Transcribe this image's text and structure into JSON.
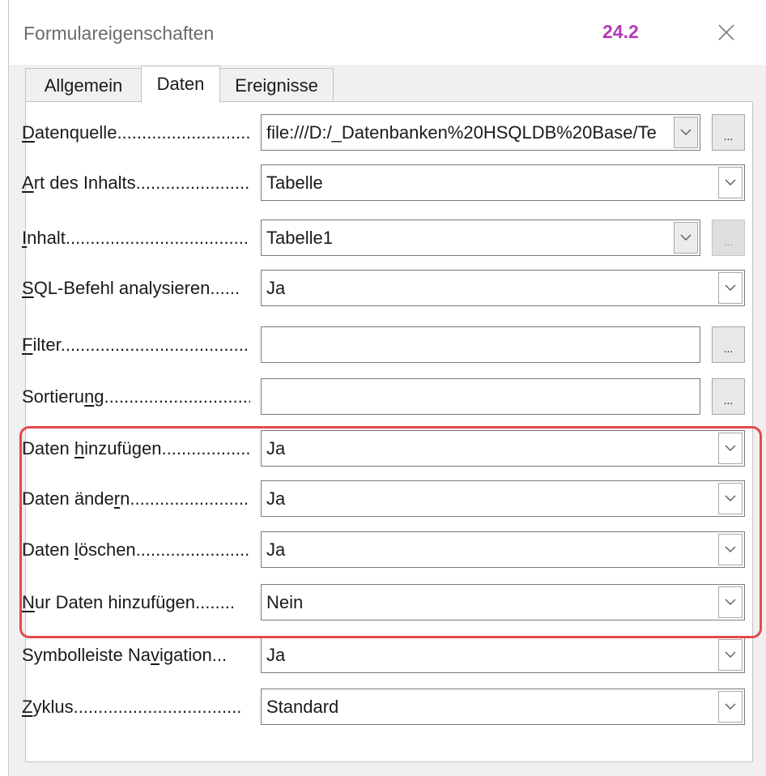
{
  "window": {
    "title": "Formulareigenschaften",
    "version": "24.2"
  },
  "tabs": [
    {
      "label": "Allgemein",
      "active": false
    },
    {
      "label": "Daten",
      "active": true
    },
    {
      "label": "Ereignisse",
      "active": false
    }
  ],
  "rows": [
    {
      "label_pre": "",
      "label_u": "D",
      "label_post": "atenquelle",
      "dots": "...............................",
      "value": "file:///D:/_Datenbanken%20HSQLDB%20Base/Te",
      "more": true,
      "more_label": "..."
    },
    {
      "label_pre": "",
      "label_u": "A",
      "label_post": "rt des Inhalts",
      "dots": ".........................",
      "value": "Tabelle"
    },
    {
      "label_pre": "",
      "label_u": "I",
      "label_post": "nhalt",
      "dots": "......................................",
      "value": "Tabelle1",
      "more": true,
      "more_label": "...",
      "more_disabled": true
    },
    {
      "label_pre": "",
      "label_u": "S",
      "label_post": "QL-Befehl analysieren",
      "dots": "......",
      "value": "Ja"
    },
    {
      "label_pre": "",
      "label_u": "F",
      "label_post": "ilter",
      "dots": "........................................",
      "value": "",
      "more": true,
      "more_label": "..."
    },
    {
      "label_pre": "Sortieru",
      "label_u": "n",
      "label_post": "g",
      "dots": "..................................",
      "value": "",
      "more": true,
      "more_label": "..."
    },
    {
      "label_pre": "Daten ",
      "label_u": "h",
      "label_post": "inzufügen",
      "dots": "..................",
      "value": "Ja"
    },
    {
      "label_pre": "Daten ände",
      "label_u": "r",
      "label_post": "n",
      "dots": "...........................",
      "value": "Ja"
    },
    {
      "label_pre": "Daten ",
      "label_u": "l",
      "label_post": "öschen",
      "dots": ".........................",
      "value": "Ja"
    },
    {
      "label_pre": "",
      "label_u": "N",
      "label_post": "ur Daten hinzufügen",
      "dots": "........",
      "value": "Nein"
    },
    {
      "label_pre": "Symbolleiste Na",
      "label_u": "v",
      "label_post": "igation",
      "dots": "...",
      "value": "Ja"
    },
    {
      "label_pre": "",
      "label_u": "Z",
      "label_post": "yklus",
      "dots": "..................................",
      "value": "Standard"
    }
  ],
  "icons": {
    "close": "close-icon",
    "dropdown": "chevron-down-icon"
  },
  "colors": {
    "version": "#b43ab4",
    "highlight": "#e5484d"
  }
}
